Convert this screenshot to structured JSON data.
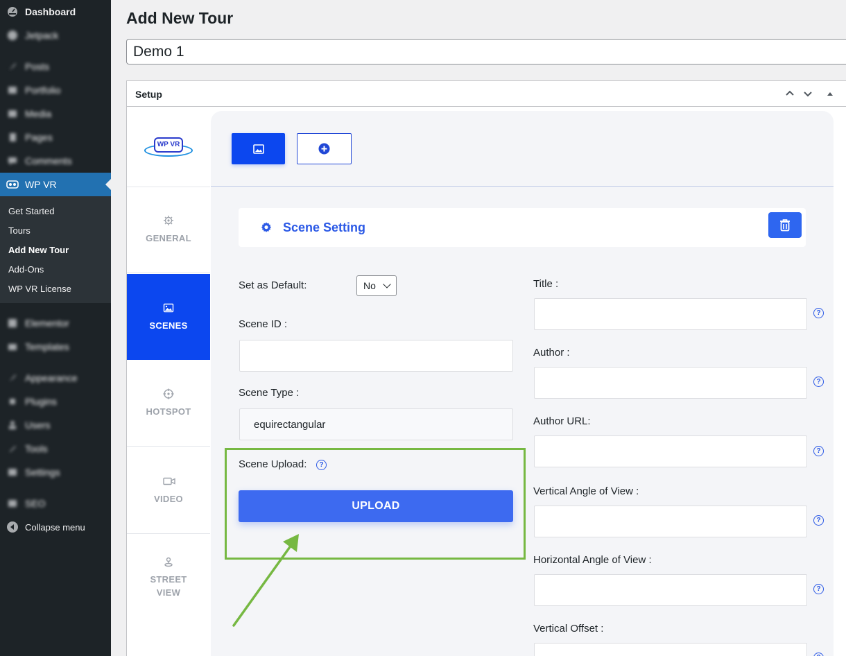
{
  "sidebar": {
    "items": [
      {
        "label": "Dashboard",
        "icon": "dashboard-icon",
        "blurred": false
      },
      {
        "label": "Jetpack",
        "icon": "jetpack-icon",
        "blurred": true
      },
      {
        "label": "Posts",
        "icon": "pin-icon",
        "blurred": true
      },
      {
        "label": "Portfolio",
        "icon": "portfolio-icon",
        "blurred": true
      },
      {
        "label": "Media",
        "icon": "media-icon",
        "blurred": true
      },
      {
        "label": "Pages",
        "icon": "pages-icon",
        "blurred": true
      },
      {
        "label": "Comments",
        "icon": "comments-icon",
        "blurred": true
      },
      {
        "label": "WP VR",
        "icon": "vr-icon",
        "active": true
      },
      {
        "label": "Elementor",
        "icon": "elementor-icon",
        "blurred": true
      },
      {
        "label": "Templates",
        "icon": "folder-icon",
        "blurred": true
      },
      {
        "label": "Appearance",
        "icon": "brush-icon",
        "blurred": true
      },
      {
        "label": "Plugins",
        "icon": "plugin-icon",
        "blurred": true
      },
      {
        "label": "Users",
        "icon": "user-icon",
        "blurred": true
      },
      {
        "label": "Tools",
        "icon": "wrench-icon",
        "blurred": true
      },
      {
        "label": "Settings",
        "icon": "settings-icon",
        "blurred": true
      },
      {
        "label": "SEO",
        "icon": "seo-icon",
        "blurred": true
      }
    ],
    "submenu": [
      "Get Started",
      "Tours",
      "Add New Tour",
      "Add-Ons",
      "WP VR License"
    ],
    "submenu_current": "Add New Tour",
    "collapse_label": "Collapse menu"
  },
  "header": {
    "title": "Add New Tour",
    "tour_title_value": "Demo 1"
  },
  "postbox": {
    "title": "Setup"
  },
  "wpvr": {
    "logo_text": "WP VR",
    "tabs": [
      {
        "label": "GENERAL",
        "icon": "gear-icon"
      },
      {
        "label": "SCENES",
        "icon": "image-icon",
        "active": true
      },
      {
        "label": "HOTSPOT",
        "icon": "crosshair-icon"
      },
      {
        "label": "VIDEO",
        "icon": "video-icon"
      },
      {
        "label": "STREET\nVIEW",
        "icon": "street-view-icon"
      }
    ],
    "scene_setting_title": "Scene Setting",
    "fields_left": {
      "set_default_label": "Set as Default:",
      "set_default_value": "No",
      "scene_id_label": "Scene ID :",
      "scene_id_value": "",
      "scene_type_label": "Scene Type :",
      "scene_type_value": "equirectangular",
      "scene_upload_label": "Scene Upload:",
      "upload_button": "UPLOAD"
    },
    "fields_right": [
      {
        "label": "Title :",
        "value": ""
      },
      {
        "label": "Author :",
        "value": ""
      },
      {
        "label": "Author URL:",
        "value": ""
      },
      {
        "label": "Vertical Angle of View :",
        "value": ""
      },
      {
        "label": "Horizontal Angle of View :",
        "value": ""
      },
      {
        "label": "Vertical Offset :",
        "value": ""
      }
    ],
    "help_glyph": "?"
  },
  "colors": {
    "accent": "#0c47ef",
    "annotation": "#76b842",
    "admin_bar": "#1d2327",
    "active_menu": "#2271b1"
  }
}
